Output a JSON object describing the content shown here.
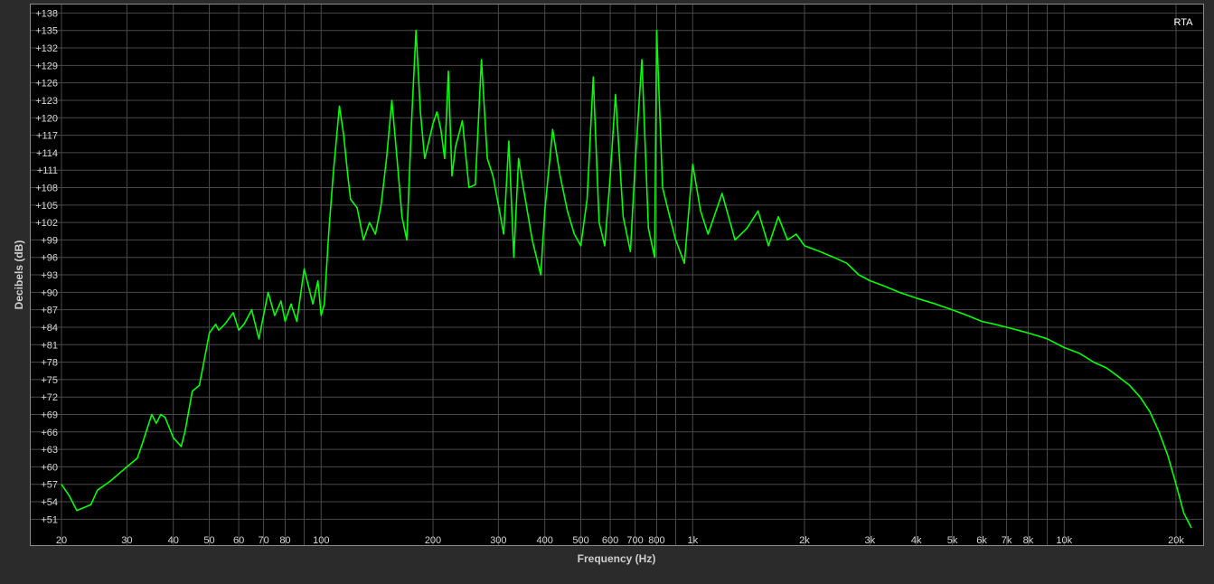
{
  "chart_data": {
    "type": "line",
    "title": "",
    "badge": "RTA",
    "xlabel": "Frequency (Hz)",
    "ylabel": "Decibels (dB)",
    "x_scale": "log",
    "xlim": [
      20,
      22000
    ],
    "ylim": [
      49.5,
      139
    ],
    "grid": true,
    "line_color": "#00ff00",
    "y_ticks": [
      "+138",
      "+135",
      "+132",
      "+129",
      "+126",
      "+123",
      "+120",
      "+117",
      "+114",
      "+111",
      "+108",
      "+105",
      "+102",
      "+99",
      "+96",
      "+93",
      "+90",
      "+87",
      "+84",
      "+81",
      "+78",
      "+75",
      "+72",
      "+69",
      "+66",
      "+63",
      "+60",
      "+57",
      "+54",
      "+51"
    ],
    "x_ticks": [
      {
        "v": 20,
        "label": "20"
      },
      {
        "v": 30,
        "label": "30"
      },
      {
        "v": 40,
        "label": "40"
      },
      {
        "v": 50,
        "label": "50"
      },
      {
        "v": 60,
        "label": "60"
      },
      {
        "v": 70,
        "label": "70"
      },
      {
        "v": 80,
        "label": "80"
      },
      {
        "v": 100,
        "label": "100"
      },
      {
        "v": 200,
        "label": "200"
      },
      {
        "v": 300,
        "label": "300"
      },
      {
        "v": 400,
        "label": "400"
      },
      {
        "v": 500,
        "label": "500"
      },
      {
        "v": 600,
        "label": "600"
      },
      {
        "v": 700,
        "label": "700"
      },
      {
        "v": 800,
        "label": "800"
      },
      {
        "v": 1000,
        "label": "1k"
      },
      {
        "v": 2000,
        "label": "2k"
      },
      {
        "v": 3000,
        "label": "3k"
      },
      {
        "v": 4000,
        "label": "4k"
      },
      {
        "v": 5000,
        "label": "5k"
      },
      {
        "v": 6000,
        "label": "6k"
      },
      {
        "v": 7000,
        "label": "7k"
      },
      {
        "v": 8000,
        "label": "8k"
      },
      {
        "v": 10000,
        "label": "10k"
      },
      {
        "v": 20000,
        "label": "20k"
      }
    ],
    "series": [
      {
        "points": [
          [
            20,
            57
          ],
          [
            21,
            55
          ],
          [
            22,
            52.5
          ],
          [
            24,
            53.5
          ],
          [
            25,
            56
          ],
          [
            27,
            57.5
          ],
          [
            30,
            60
          ],
          [
            32,
            61.5
          ],
          [
            33,
            64
          ],
          [
            35,
            69
          ],
          [
            36,
            67.5
          ],
          [
            37,
            69
          ],
          [
            38,
            68.5
          ],
          [
            40,
            65
          ],
          [
            42,
            63.5
          ],
          [
            43,
            66
          ],
          [
            45,
            73
          ],
          [
            47,
            74
          ],
          [
            48,
            77
          ],
          [
            50,
            83
          ],
          [
            52,
            84.5
          ],
          [
            53,
            83.5
          ],
          [
            55,
            84.5
          ],
          [
            58,
            86.5
          ],
          [
            60,
            83.5
          ],
          [
            62,
            84.5
          ],
          [
            65,
            87
          ],
          [
            68,
            82
          ],
          [
            72,
            90
          ],
          [
            75,
            86
          ],
          [
            78,
            88.5
          ],
          [
            80,
            85
          ],
          [
            83,
            88
          ],
          [
            86,
            85
          ],
          [
            90,
            94
          ],
          [
            95,
            88
          ],
          [
            98,
            92
          ],
          [
            100,
            86
          ],
          [
            102,
            88
          ],
          [
            105,
            101
          ],
          [
            108,
            111
          ],
          [
            112,
            122
          ],
          [
            115,
            117
          ],
          [
            118,
            110
          ],
          [
            120,
            106
          ],
          [
            125,
            104.5
          ],
          [
            130,
            99
          ],
          [
            135,
            102
          ],
          [
            140,
            100
          ],
          [
            145,
            105
          ],
          [
            150,
            113
          ],
          [
            155,
            123
          ],
          [
            160,
            113
          ],
          [
            165,
            103
          ],
          [
            170,
            99
          ],
          [
            175,
            119
          ],
          [
            180,
            135
          ],
          [
            185,
            121
          ],
          [
            190,
            113
          ],
          [
            195,
            116
          ],
          [
            200,
            119
          ],
          [
            205,
            121
          ],
          [
            210,
            118
          ],
          [
            215,
            113
          ],
          [
            220,
            128
          ],
          [
            225,
            110
          ],
          [
            230,
            115
          ],
          [
            240,
            119.5
          ],
          [
            250,
            108
          ],
          [
            260,
            108.5
          ],
          [
            270,
            130
          ],
          [
            280,
            113
          ],
          [
            290,
            110
          ],
          [
            300,
            105
          ],
          [
            310,
            100
          ],
          [
            320,
            116
          ],
          [
            330,
            96
          ],
          [
            340,
            113
          ],
          [
            350,
            108
          ],
          [
            370,
            99
          ],
          [
            390,
            93
          ],
          [
            400,
            104
          ],
          [
            420,
            118
          ],
          [
            440,
            110
          ],
          [
            460,
            104
          ],
          [
            480,
            100
          ],
          [
            500,
            98
          ],
          [
            520,
            106
          ],
          [
            540,
            127
          ],
          [
            560,
            102
          ],
          [
            580,
            98
          ],
          [
            600,
            110
          ],
          [
            620,
            124
          ],
          [
            650,
            103
          ],
          [
            680,
            97
          ],
          [
            700,
            112
          ],
          [
            730,
            130
          ],
          [
            760,
            101
          ],
          [
            790,
            96
          ],
          [
            800,
            135
          ],
          [
            830,
            108
          ],
          [
            860,
            104
          ],
          [
            900,
            99
          ],
          [
            950,
            95
          ],
          [
            1000,
            112
          ],
          [
            1050,
            104
          ],
          [
            1100,
            100
          ],
          [
            1200,
            107
          ],
          [
            1300,
            99
          ],
          [
            1400,
            101
          ],
          [
            1500,
            104
          ],
          [
            1600,
            98
          ],
          [
            1700,
            103
          ],
          [
            1800,
            99
          ],
          [
            1900,
            100
          ],
          [
            2000,
            98
          ],
          [
            2200,
            97
          ],
          [
            2400,
            96
          ],
          [
            2600,
            95
          ],
          [
            2800,
            93
          ],
          [
            3000,
            92
          ],
          [
            3300,
            91
          ],
          [
            3600,
            90
          ],
          [
            4000,
            89
          ],
          [
            4500,
            88
          ],
          [
            5000,
            87
          ],
          [
            5500,
            86
          ],
          [
            6000,
            85
          ],
          [
            6500,
            84.5
          ],
          [
            7000,
            84
          ],
          [
            7500,
            83.5
          ],
          [
            8000,
            83
          ],
          [
            8500,
            82.5
          ],
          [
            9000,
            82
          ],
          [
            10000,
            80.5
          ],
          [
            11000,
            79.5
          ],
          [
            12000,
            78
          ],
          [
            13000,
            77
          ],
          [
            14000,
            75.5
          ],
          [
            15000,
            74
          ],
          [
            16000,
            72
          ],
          [
            17000,
            69.5
          ],
          [
            18000,
            66
          ],
          [
            19000,
            62
          ],
          [
            20000,
            57
          ],
          [
            21000,
            52
          ],
          [
            22000,
            49.5
          ]
        ]
      }
    ]
  }
}
